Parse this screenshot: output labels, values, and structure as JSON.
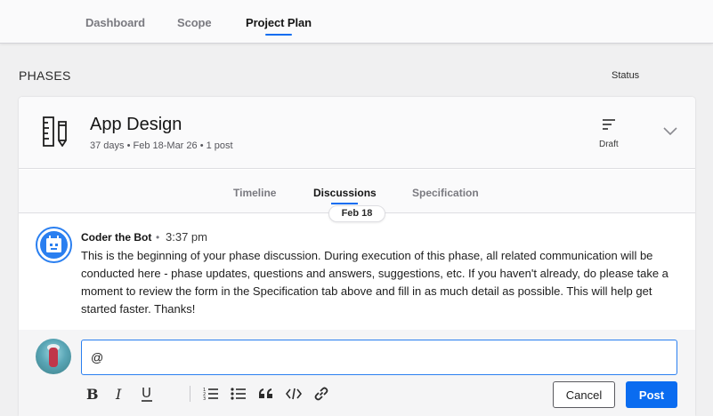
{
  "nav": {
    "tabs": [
      {
        "label": "Dashboard"
      },
      {
        "label": "Scope"
      },
      {
        "label": "Project Plan"
      }
    ],
    "active_tab": "Project Plan"
  },
  "section": {
    "title": "PHASES",
    "status_header": "Status"
  },
  "phase": {
    "icon": "ruler-pencil-icon",
    "name": "App Design",
    "meta": "37 days • Feb 18-Mar 26 • 1 post",
    "status": "Draft",
    "status_icon": "lines-icon"
  },
  "subtabs": {
    "items": [
      {
        "label": "Timeline"
      },
      {
        "label": "Discussions"
      },
      {
        "label": "Specification"
      }
    ],
    "active": "Discussions",
    "date_pill": "Feb 18"
  },
  "post": {
    "author": "Coder the Bot",
    "separator": "•",
    "time": "3:37 pm",
    "body": "This is the beginning of your phase discussion. During execution of this phase, all related communication will be conducted here - phase updates, questions and answers, suggestions, etc. If you haven't already, do please take a moment to review the form in the Specification tab above and fill in as much detail as possible. This will help get started faster. Thanks!",
    "avatar_icon": "calendar-bot-icon"
  },
  "composer": {
    "value": "@",
    "toolbar": [
      "bold-icon",
      "italic-icon",
      "underline-icon",
      "ordered-list-icon",
      "bullet-list-icon",
      "quote-icon",
      "code-icon",
      "link-icon"
    ],
    "cancel_label": "Cancel",
    "post_label": "Post"
  },
  "colors": {
    "accent": "#0a6cf0",
    "background": "#f0f0f1"
  }
}
